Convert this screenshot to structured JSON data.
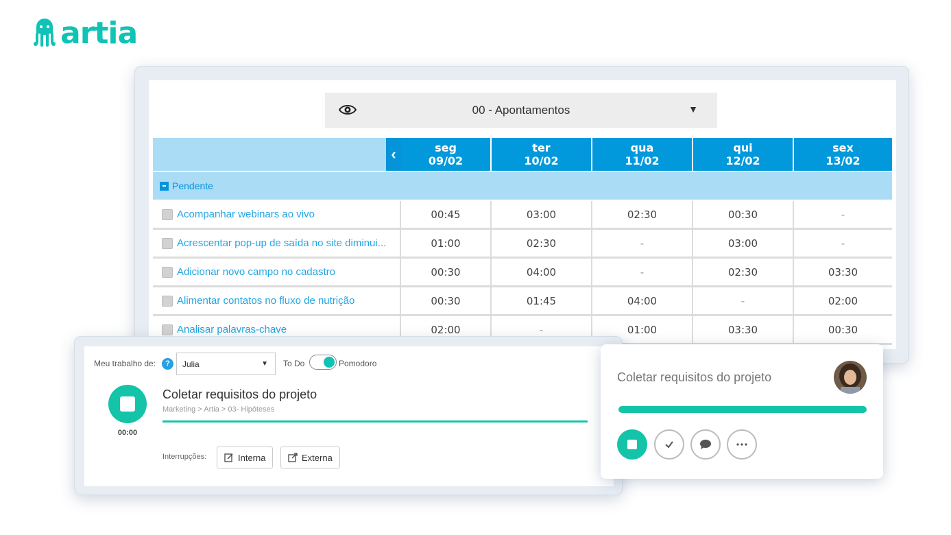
{
  "brand": {
    "name": "artia",
    "color": "#10c3b5",
    "icon": "octopus-icon"
  },
  "view": {
    "icon": "eye-icon",
    "title": "00 - Apontamentos",
    "caret": "▼"
  },
  "nav": {
    "prev": "‹"
  },
  "days": [
    {
      "name": "seg",
      "date": "09/02"
    },
    {
      "name": "ter",
      "date": "10/02"
    },
    {
      "name": "qua",
      "date": "11/02"
    },
    {
      "name": "qui",
      "date": "12/02"
    },
    {
      "name": "sex",
      "date": "13/02"
    }
  ],
  "section": {
    "label": "Pendente"
  },
  "tasks": [
    {
      "name": "Acompanhar webinars ao vivo",
      "hours": [
        "00:45",
        "03:00",
        "02:30",
        "00:30",
        "-"
      ]
    },
    {
      "name": "Acrescentar pop-up de saída no site diminui...",
      "hours": [
        "01:00",
        "02:30",
        "-",
        "03:00",
        "-"
      ]
    },
    {
      "name": "Adicionar novo campo no cadastro",
      "hours": [
        "00:30",
        "04:00",
        "-",
        "02:30",
        "03:30"
      ]
    },
    {
      "name": "Alimentar contatos no fluxo de nutrição",
      "hours": [
        "00:30",
        "01:45",
        "04:00",
        "-",
        "02:00"
      ]
    },
    {
      "name": "Analisar palavras-chave",
      "hours": [
        "02:00",
        "-",
        "01:00",
        "03:30",
        "00:30"
      ]
    }
  ],
  "timer": {
    "my_work_label": "Meu trabalho de:",
    "help": "?",
    "user": "Julia",
    "todo_label": "To Do",
    "pomodoro_label": "Pomodoro",
    "pomodoro_on": true,
    "task_title": "Coletar requisitos do projeto",
    "task_path": "Marketing > Artia > 03- Hipóteses",
    "elapsed": "00:00",
    "interruptions_label": "Interrupções:",
    "internal_label": "Interna",
    "external_label": "Externa"
  },
  "card": {
    "title": "Coletar requisitos do projeto",
    "accent": "#14c4a8",
    "actions": [
      "stop-icon",
      "check-icon",
      "comment-icon",
      "more-icon"
    ]
  }
}
